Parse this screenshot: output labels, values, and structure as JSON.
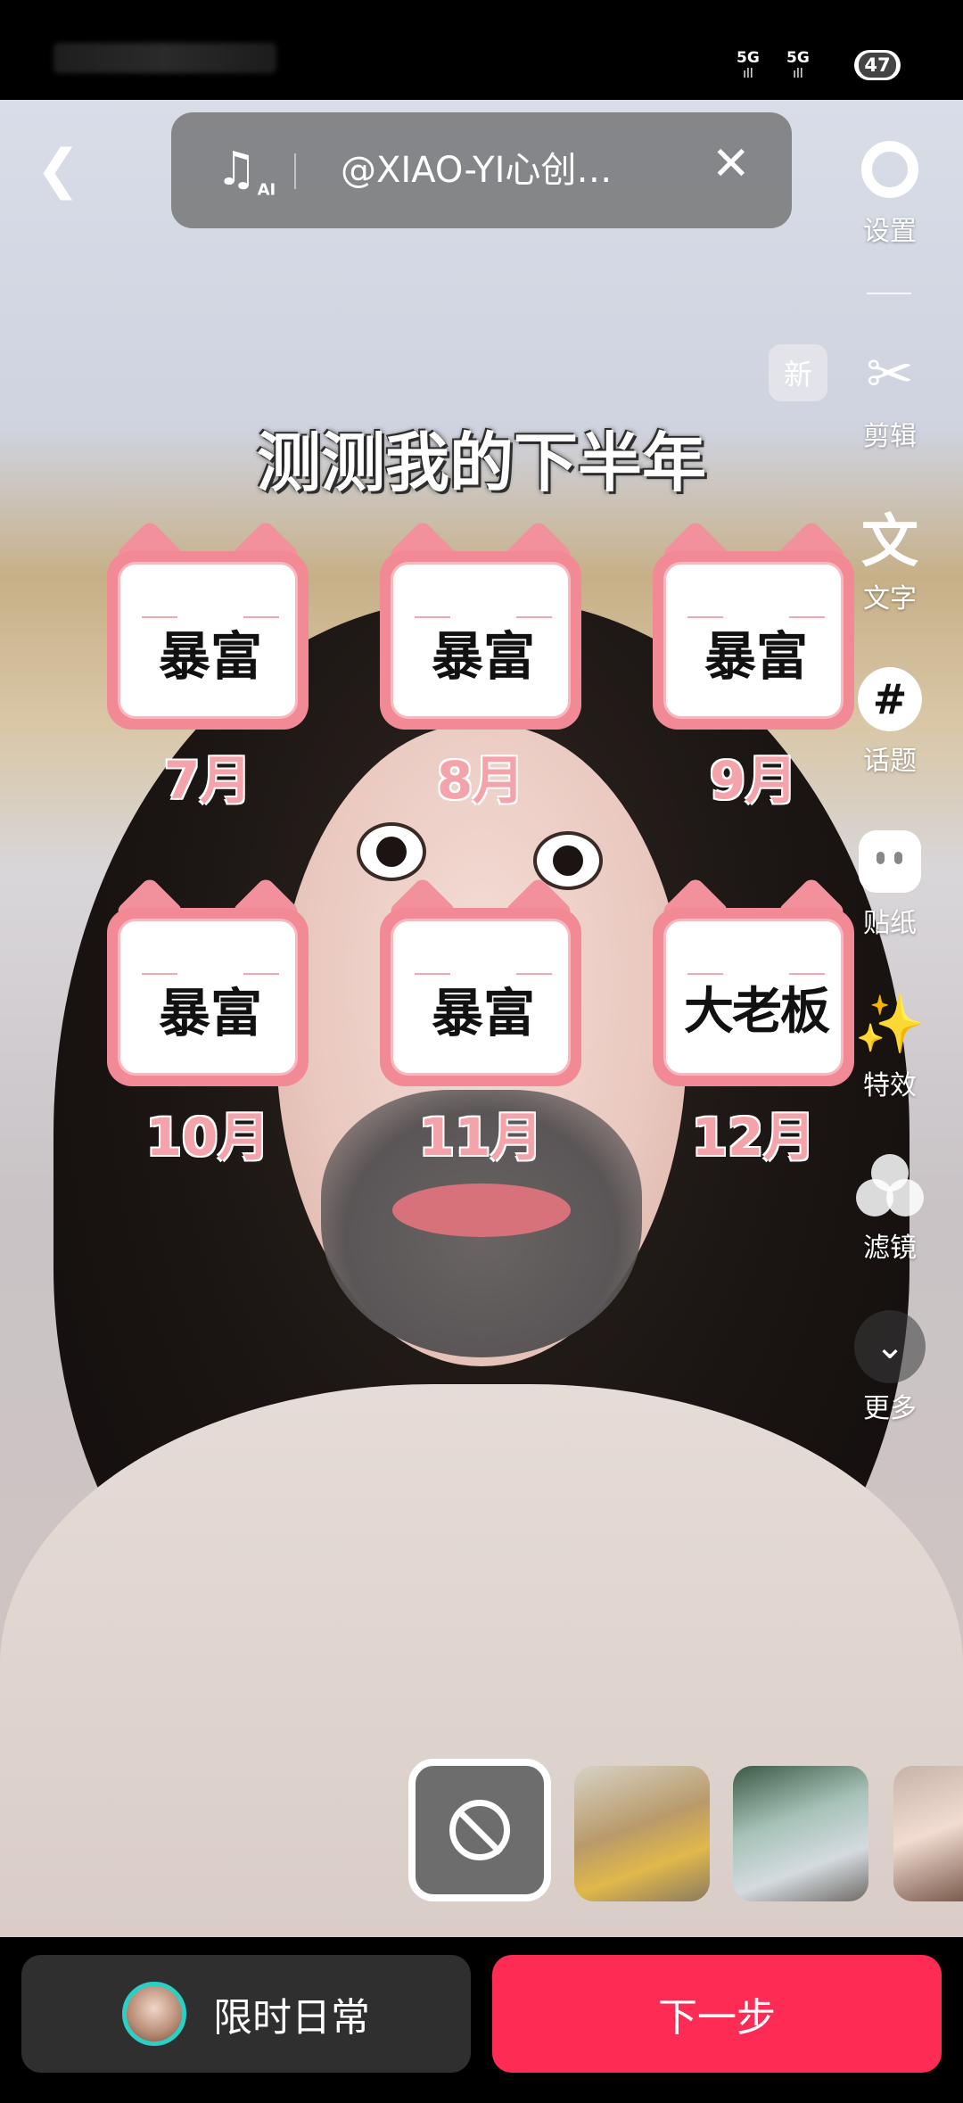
{
  "status_bar": {
    "signal1": "5G",
    "signal2": "5G",
    "battery": "47"
  },
  "top_bar": {
    "music_text": "@XIAO-YI心创…",
    "ai_badge": "AI"
  },
  "tools": [
    {
      "id": "settings",
      "label": "设置"
    },
    {
      "id": "cut",
      "label": "剪辑"
    },
    {
      "id": "text",
      "label": "文字",
      "glyph": "文"
    },
    {
      "id": "topic",
      "label": "话题",
      "glyph": "#"
    },
    {
      "id": "sticker",
      "label": "贴纸"
    },
    {
      "id": "effects",
      "label": "特效"
    },
    {
      "id": "filter",
      "label": "滤镜"
    },
    {
      "id": "more",
      "label": "更多"
    }
  ],
  "new_badge": "新",
  "filter_overlay": {
    "title": "测测我的下半年",
    "cards": [
      {
        "word": "暴富",
        "month": "7月"
      },
      {
        "word": "暴富",
        "month": "8月"
      },
      {
        "word": "暴富",
        "month": "9月"
      },
      {
        "word": "暴富",
        "month": "10月"
      },
      {
        "word": "暴富",
        "month": "11月"
      },
      {
        "word": "大老板",
        "month": "12月"
      }
    ]
  },
  "bottom": {
    "daily_label": "限时日常",
    "next_label": "下一步"
  },
  "colors": {
    "accent": "#fe2c55",
    "card_pink": "#f28a96",
    "month_pink": "#f4a3aa"
  }
}
